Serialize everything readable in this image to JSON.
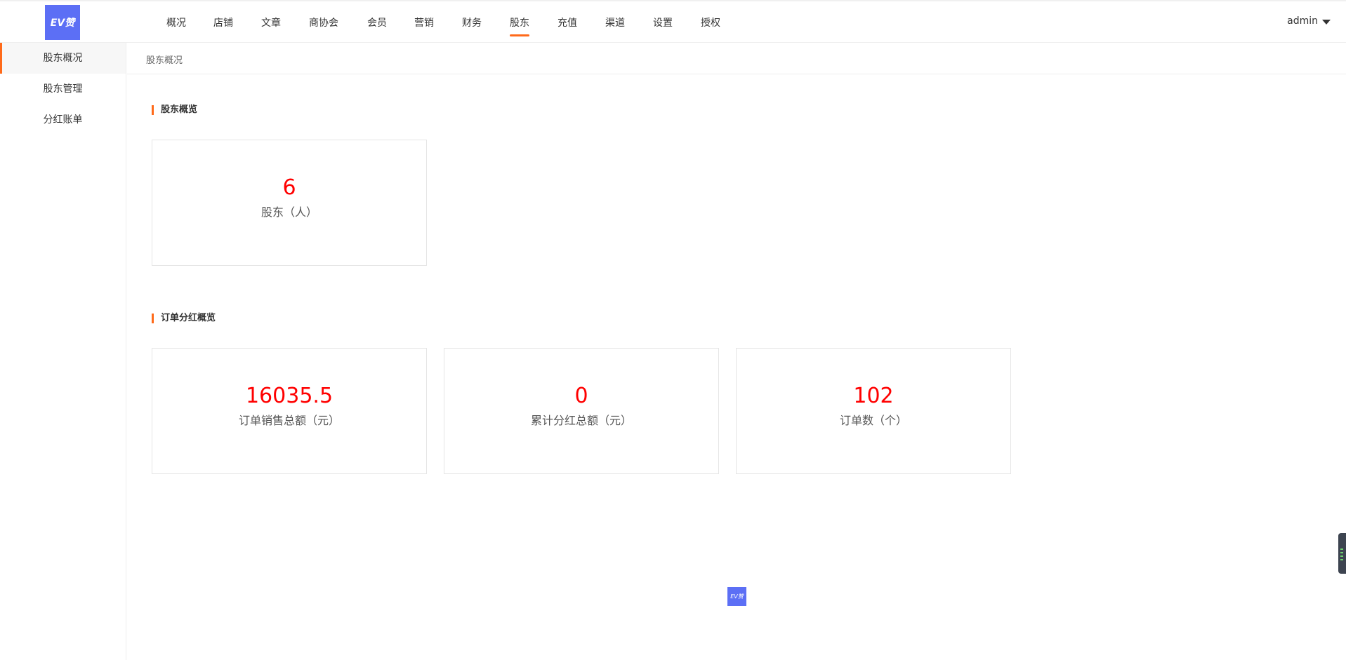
{
  "header": {
    "logo_text": "EV赞",
    "nav": [
      {
        "label": "概况"
      },
      {
        "label": "店铺"
      },
      {
        "label": "文章"
      },
      {
        "label": "商协会"
      },
      {
        "label": "会员"
      },
      {
        "label": "营销"
      },
      {
        "label": "财务"
      },
      {
        "label": "股东"
      },
      {
        "label": "充值"
      },
      {
        "label": "渠道"
      },
      {
        "label": "设置"
      },
      {
        "label": "授权"
      }
    ],
    "active_nav": "股东",
    "user": "admin"
  },
  "sidebar": {
    "items": [
      {
        "label": "股东概况",
        "active": true
      },
      {
        "label": "股东管理",
        "active": false
      },
      {
        "label": "分红账单",
        "active": false
      }
    ]
  },
  "breadcrumb": "股东概况",
  "sections": [
    {
      "title": "股东概览",
      "cards": [
        {
          "value": "6",
          "label": "股东（人）"
        }
      ]
    },
    {
      "title": "订单分红概览",
      "cards": [
        {
          "value": "16035.5",
          "label": "订单销售总额（元）"
        },
        {
          "value": "0",
          "label": "累计分红总额（元）"
        },
        {
          "value": "102",
          "label": "订单数（个）"
        }
      ]
    }
  ],
  "footer": {
    "logo_text": "EV赞"
  },
  "colors": {
    "accent": "#ff6a1a",
    "brand": "#5c6ff5",
    "value": "#ff0000"
  }
}
